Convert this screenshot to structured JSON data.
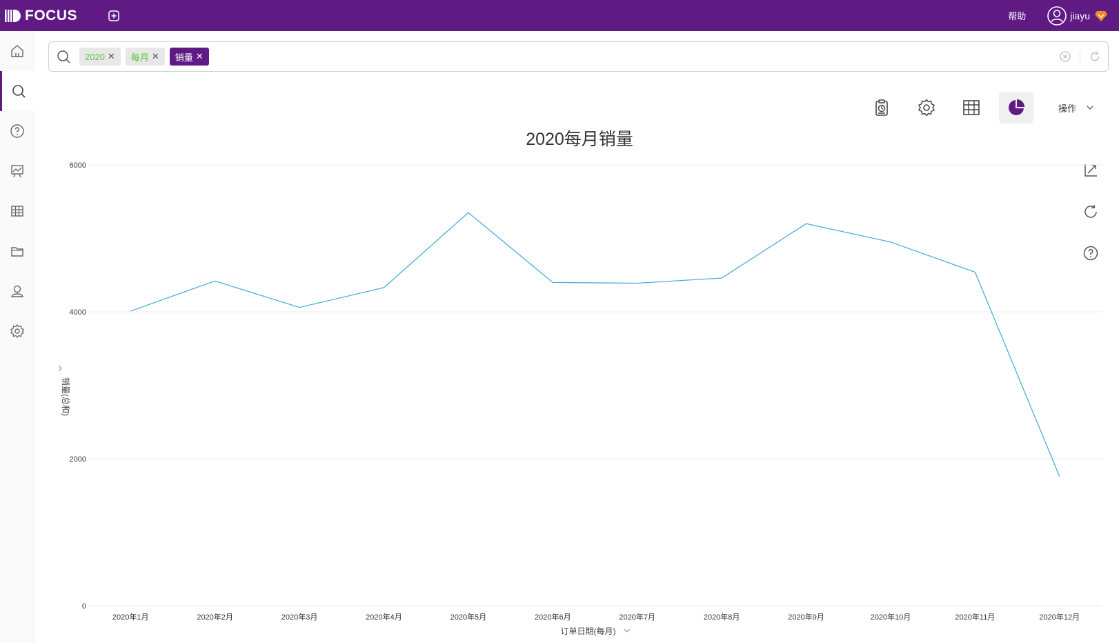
{
  "app": {
    "name": "FOCUS"
  },
  "header": {
    "help": "帮助",
    "username": "jiayu",
    "brand_color": "#5f1a84"
  },
  "sidebar": {
    "items": [
      {
        "name": "home",
        "icon": "home-icon"
      },
      {
        "name": "search",
        "icon": "search-icon",
        "active": true
      },
      {
        "name": "help",
        "icon": "question-icon"
      },
      {
        "name": "dashboard",
        "icon": "presentation-icon"
      },
      {
        "name": "table",
        "icon": "table-icon"
      },
      {
        "name": "folder",
        "icon": "folder-icon"
      },
      {
        "name": "user",
        "icon": "user-icon"
      },
      {
        "name": "settings",
        "icon": "gear-icon"
      }
    ]
  },
  "search": {
    "chips": [
      {
        "label": "2020",
        "style": "green"
      },
      {
        "label": "每月",
        "style": "green"
      },
      {
        "label": "销量",
        "style": "purple"
      }
    ]
  },
  "toolbar": {
    "operations": "操作"
  },
  "chart_data": {
    "type": "line",
    "title": "2020每月销量",
    "xlabel": "订单日期(每月)",
    "ylabel": "销量(总和)",
    "categories": [
      "2020年1月",
      "2020年2月",
      "2020年3月",
      "2020年4月",
      "2020年5月",
      "2020年6月",
      "2020年7月",
      "2020年8月",
      "2020年9月",
      "2020年10月",
      "2020年11月",
      "2020年12月"
    ],
    "values": [
      4010,
      4420,
      4060,
      4330,
      5350,
      4400,
      4390,
      4460,
      5200,
      4950,
      4540,
      1760
    ],
    "ylim": [
      0,
      6000
    ],
    "yticks": [
      0,
      2000,
      4000,
      6000
    ],
    "line_color": "#4aaed9",
    "grid": true
  }
}
